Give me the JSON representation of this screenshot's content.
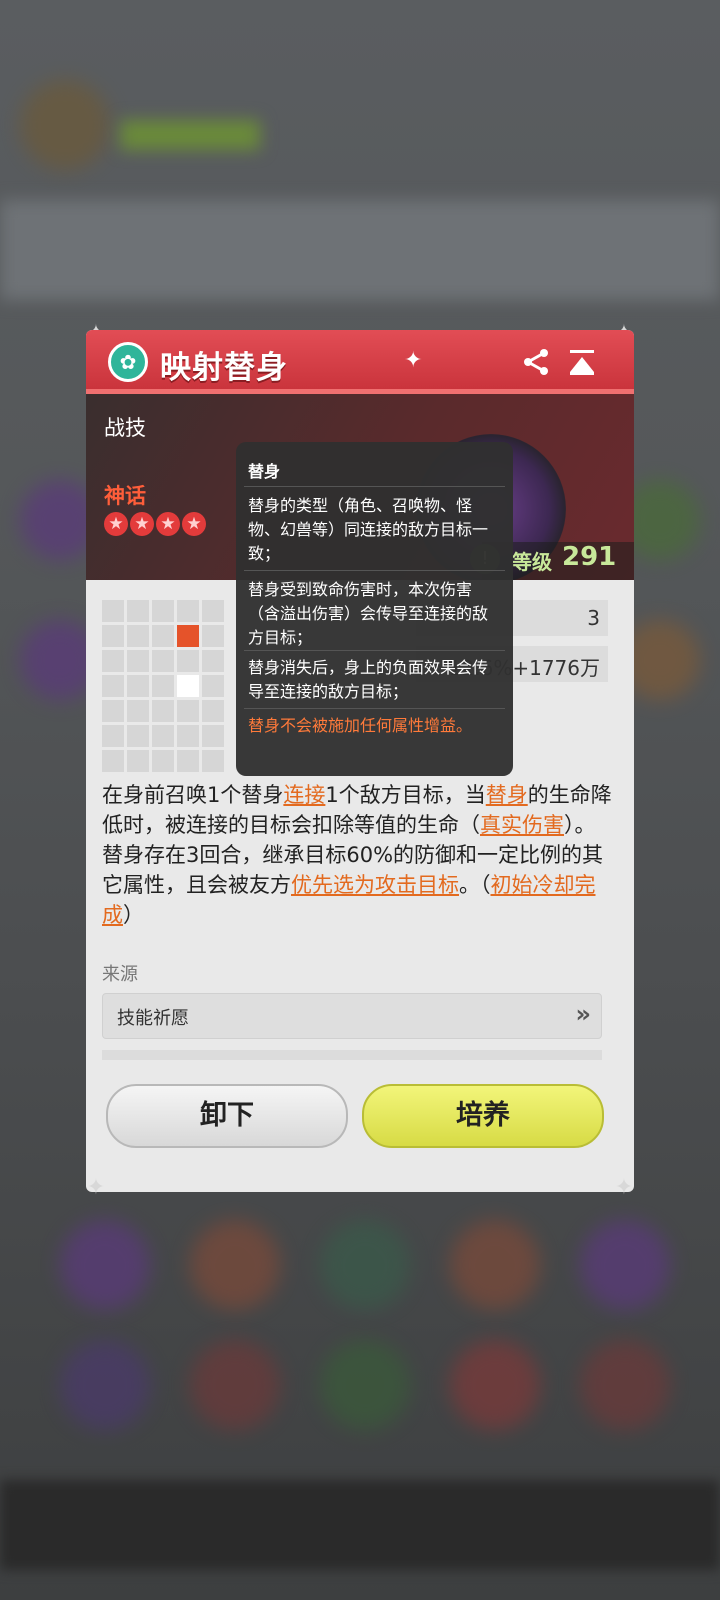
{
  "skill": {
    "name": "映射替身",
    "category": "战技",
    "rarity": "神话",
    "stars": 4,
    "level_label": "等级",
    "level_value": "291"
  },
  "icons": {
    "type": "sparkle-mask-icon",
    "share": "share-icon",
    "collapse": "collapse-up-icon",
    "info": "info-icon",
    "source_arrow": "double-chevron-right-icon",
    "star": "star-icon"
  },
  "stats": [
    {
      "value": "3"
    },
    {
      "value": "12.6%+1776万"
    }
  ],
  "range_grid": {
    "rows": 7,
    "cols": 5,
    "highlighted": [
      [
        1,
        3
      ]
    ],
    "self": [
      [
        3,
        3
      ]
    ]
  },
  "description": {
    "p1": "在身前召唤1个替身",
    "k1": "连接",
    "p2": "1个敌方目标，当",
    "k2": "替身",
    "p3": "的生命降低时，被连接的目标会扣除等值的生命（",
    "k3": "真实伤害",
    "p4": "）。替身存在3回合，继承目标60%的防御和一定比例的其它属性，且会被友方",
    "k4": "优先选为攻击目标",
    "p5": "。（",
    "k5": "初始冷却完成",
    "p6": "）"
  },
  "source": {
    "label": "来源",
    "value": "技能祈愿"
  },
  "buttons": {
    "unequip": "卸下",
    "train": "培养"
  },
  "tooltip": {
    "title": "替身",
    "line1": "替身的类型（角色、召唤物、怪物、幻兽等）同连接的敌方目标一致；",
    "line2": "替身受到致命伤害时，本次伤害（含溢出伤害）会传导至连接的敌方目标；",
    "line3": "替身消失后，身上的负面效果会传导至连接的敌方目标；",
    "warning": "替身不会被施加任何属性增益。"
  },
  "colors": {
    "header": "#d93c45",
    "rarity": "#ff5e3a",
    "keyword": "#e36a1f",
    "level": "#c8e89a",
    "train_button": "#e3e65a"
  }
}
